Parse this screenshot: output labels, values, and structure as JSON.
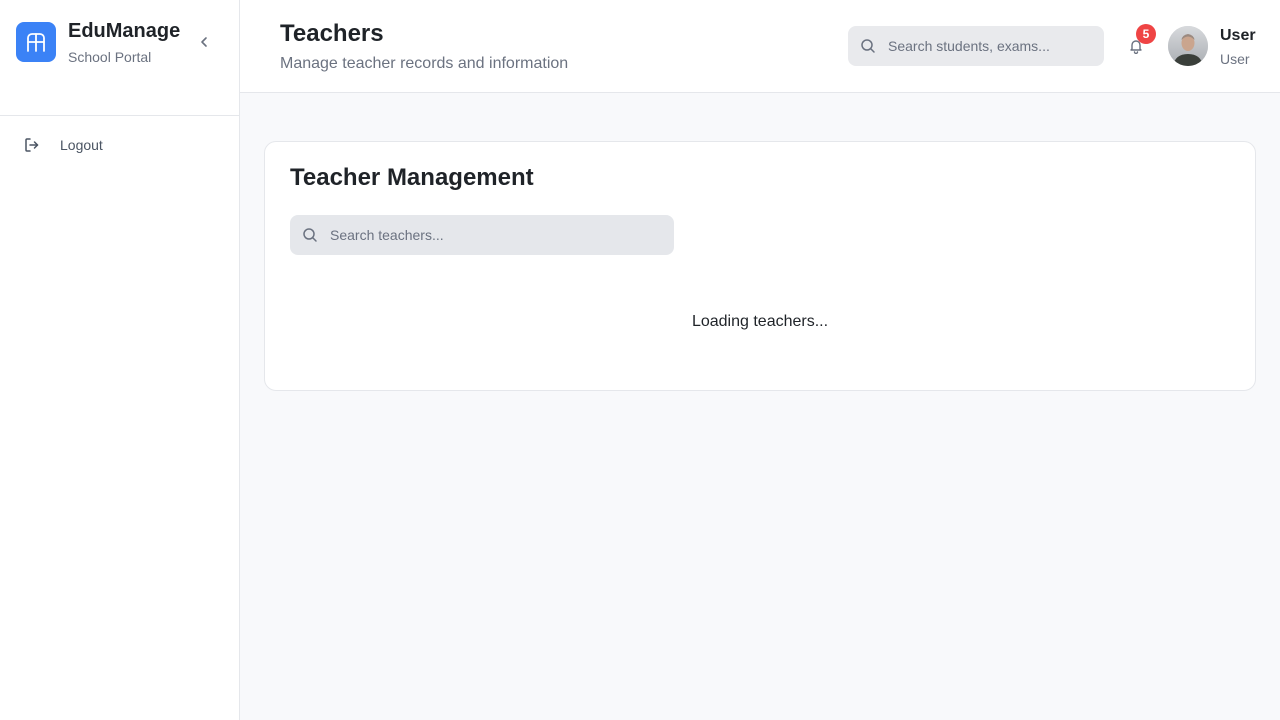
{
  "brand": {
    "name": "EduManage",
    "subtitle": "School Portal",
    "accent": "#3b82f6"
  },
  "sidebar": {
    "items": [
      {
        "label": "Logout",
        "icon": "logout-icon"
      }
    ]
  },
  "header": {
    "title": "Teachers",
    "subtitle": "Manage teacher records and information",
    "search_placeholder": "Search students, exams...",
    "notifications_count": "5",
    "user": {
      "name": "User",
      "role": "User"
    }
  },
  "main": {
    "card_title": "Teacher Management",
    "search_placeholder": "Search teachers...",
    "loading_text": "Loading teachers..."
  },
  "colors": {
    "badge": "#ef4444",
    "border": "#e5e7eb",
    "background": "#f8f9fb"
  }
}
